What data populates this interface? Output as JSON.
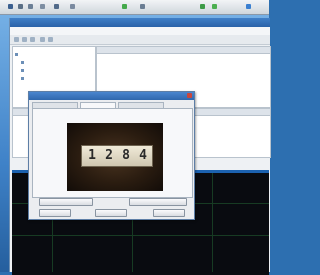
{
  "plate": {
    "digits": [
      "1",
      "2",
      "8",
      "4"
    ]
  }
}
